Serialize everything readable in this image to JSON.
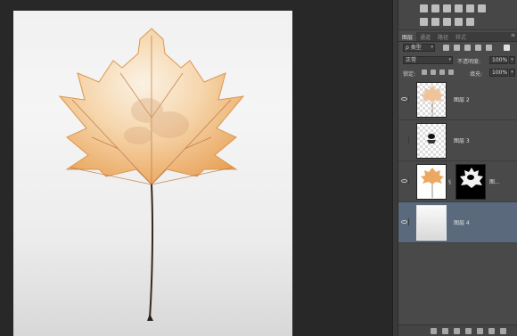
{
  "panel": {
    "tabs": [
      {
        "label": "图层",
        "active": true
      },
      {
        "label": "通道",
        "active": false
      },
      {
        "label": "路径",
        "active": false
      },
      {
        "label": "样式",
        "active": false
      }
    ],
    "tab_menu_icon": "menu-lines-icon",
    "filter": {
      "label": "ρ 类型"
    },
    "blend_mode": {
      "value": "正常"
    },
    "opacity": {
      "label": "不透明度:",
      "value": "100%"
    },
    "lock": {
      "label": "锁定:"
    },
    "fill": {
      "label": "填充:",
      "value": "100%"
    },
    "layers": [
      {
        "name": "图层 2",
        "visible": true,
        "selected": false
      },
      {
        "name": "图层 3",
        "visible": false,
        "selected": false
      },
      {
        "name": "图...",
        "visible": true,
        "selected": false,
        "has_mask": true
      },
      {
        "name": "图层 4",
        "visible": true,
        "selected": true
      }
    ],
    "bottom_icons": [
      "link-icon",
      "fx-icon",
      "mask-icon",
      "adjustment-icon",
      "folder-icon",
      "new-layer-icon",
      "trash-icon"
    ]
  },
  "colors": {
    "workspace": "#282828",
    "panel": "#4a4a4a",
    "selected_layer": "#5a6a7c",
    "leaf": "#e9a45b"
  }
}
